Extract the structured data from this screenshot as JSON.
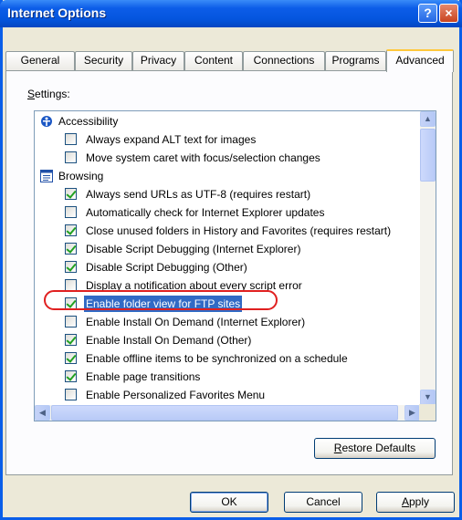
{
  "window": {
    "title": "Internet Options",
    "help_glyph": "?",
    "close_glyph": "×"
  },
  "tabs": [
    {
      "label": "General"
    },
    {
      "label": "Security"
    },
    {
      "label": "Privacy"
    },
    {
      "label": "Content"
    },
    {
      "label": "Connections"
    },
    {
      "label": "Programs"
    },
    {
      "label": "Advanced",
      "active": true
    }
  ],
  "settings": {
    "label_first": "S",
    "label_rest": "ettings:",
    "categories": [
      {
        "label": "Accessibility",
        "icon": "accessibility-icon",
        "items": [
          {
            "label": "Always expand ALT text for images",
            "checked": false
          },
          {
            "label": "Move system caret with focus/selection changes",
            "checked": false
          }
        ]
      },
      {
        "label": "Browsing",
        "icon": "browsing-icon",
        "items": [
          {
            "label": "Always send URLs as UTF-8 (requires restart)",
            "checked": true
          },
          {
            "label": "Automatically check for Internet Explorer updates",
            "checked": false
          },
          {
            "label": "Close unused folders in History and Favorites (requires restart)",
            "checked": true
          },
          {
            "label": "Disable Script Debugging (Internet Explorer)",
            "checked": true
          },
          {
            "label": "Disable Script Debugging (Other)",
            "checked": true
          },
          {
            "label": "Display a notification about every script error",
            "checked": false
          },
          {
            "label": "Enable folder view for FTP sites",
            "checked": true,
            "selected": true
          },
          {
            "label": "Enable Install On Demand (Internet Explorer)",
            "checked": false
          },
          {
            "label": "Enable Install On Demand (Other)",
            "checked": true
          },
          {
            "label": "Enable offline items to be synchronized on a schedule",
            "checked": true
          },
          {
            "label": "Enable page transitions",
            "checked": true
          },
          {
            "label": "Enable Personalized Favorites Menu",
            "checked": false
          }
        ]
      }
    ]
  },
  "buttons": {
    "restore_first": "R",
    "restore_rest": "estore Defaults",
    "ok": "OK",
    "cancel": "Cancel",
    "apply_first": "A",
    "apply_rest": "pply"
  },
  "colors": {
    "titlebar": "#0455DE",
    "selection": "#316AC5",
    "highlight_oval": "#E02020",
    "check": "#21A121"
  }
}
